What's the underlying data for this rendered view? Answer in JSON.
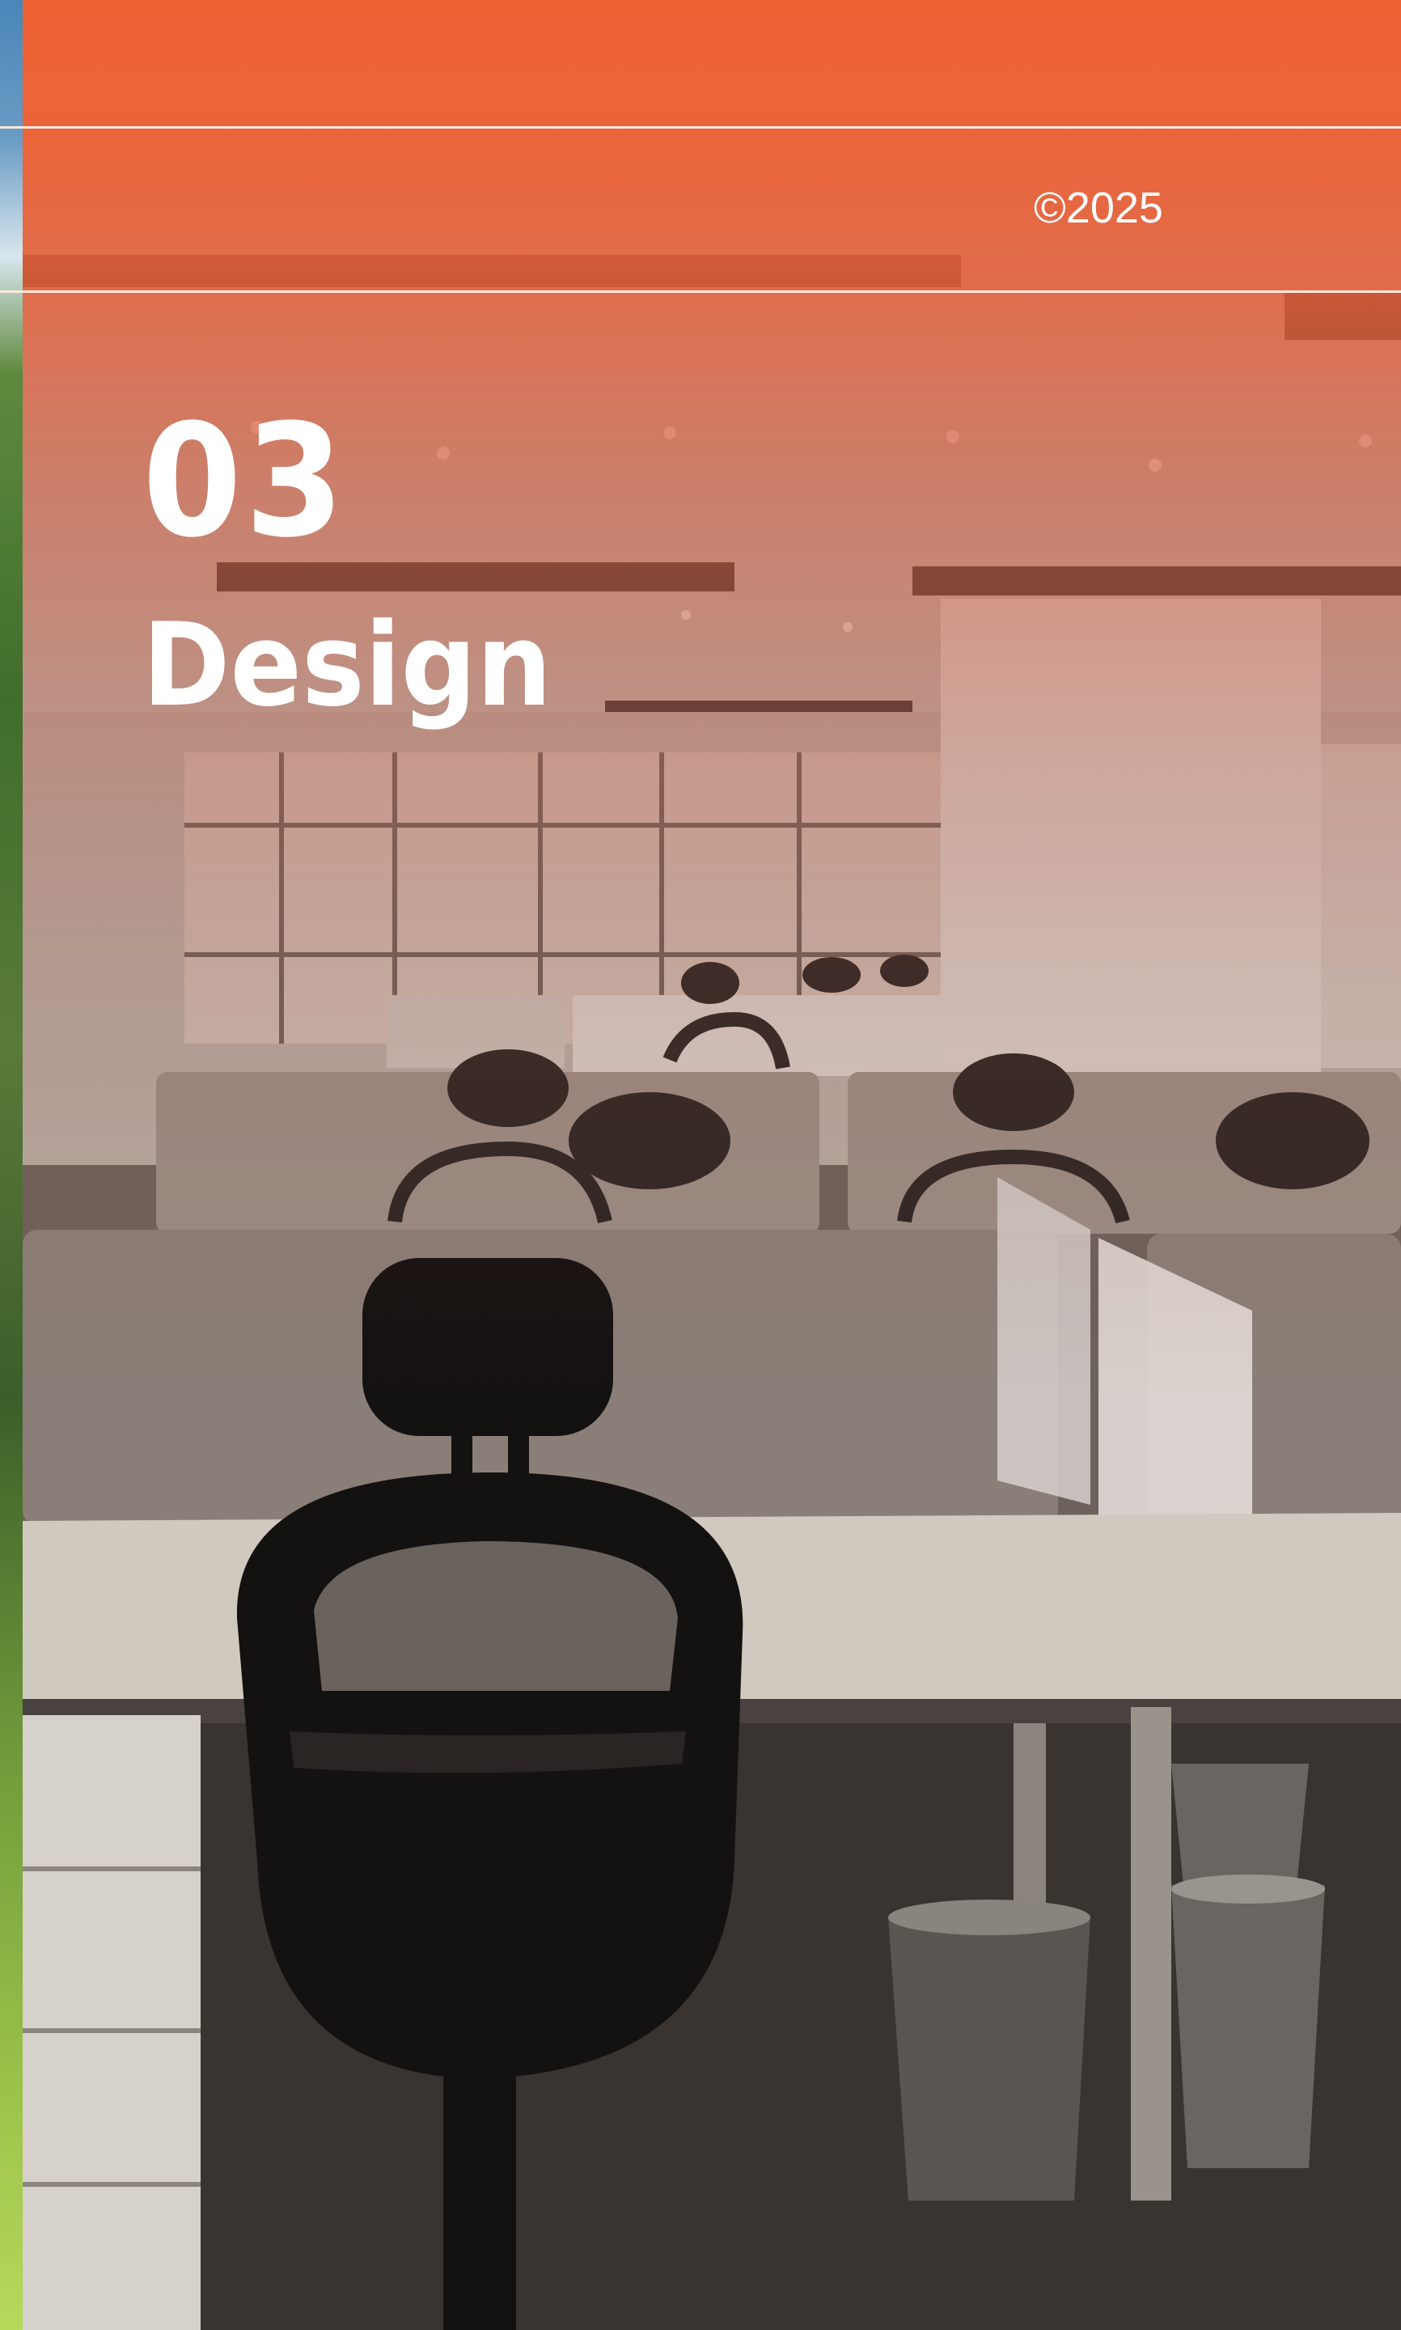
{
  "header": {
    "copyright": "©2025"
  },
  "section": {
    "number": "03",
    "title": "Design"
  },
  "colors": {
    "accent": "#EE6234",
    "rule": "#FBE7DC",
    "text": "#FFFFFF"
  },
  "image": {
    "subject": "office-workstations-photo"
  }
}
